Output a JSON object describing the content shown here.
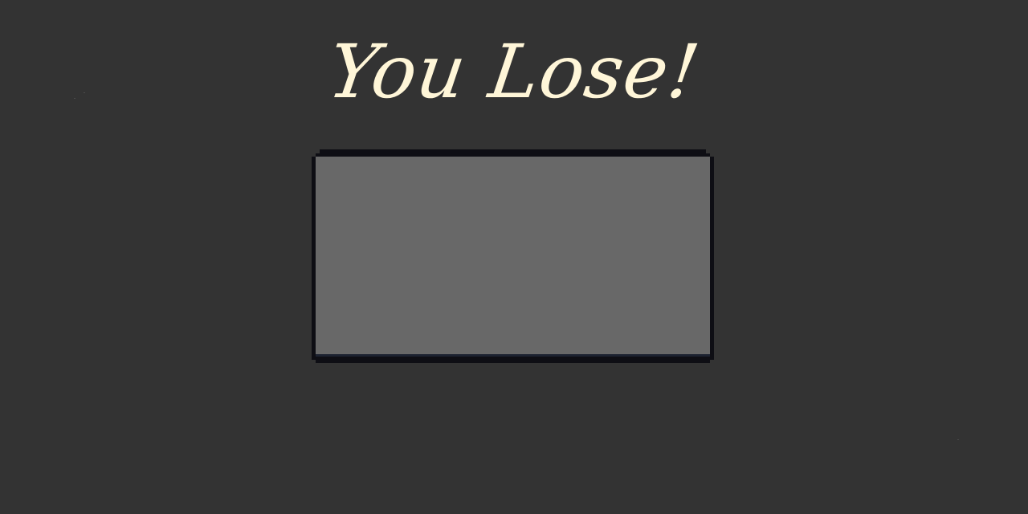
{
  "screen": {
    "title": "You Lose!",
    "title_color": "#fff6d8",
    "background_color": "#333333"
  },
  "panel": {
    "fill_color": "#686868",
    "border_color": "#0e0e14"
  }
}
